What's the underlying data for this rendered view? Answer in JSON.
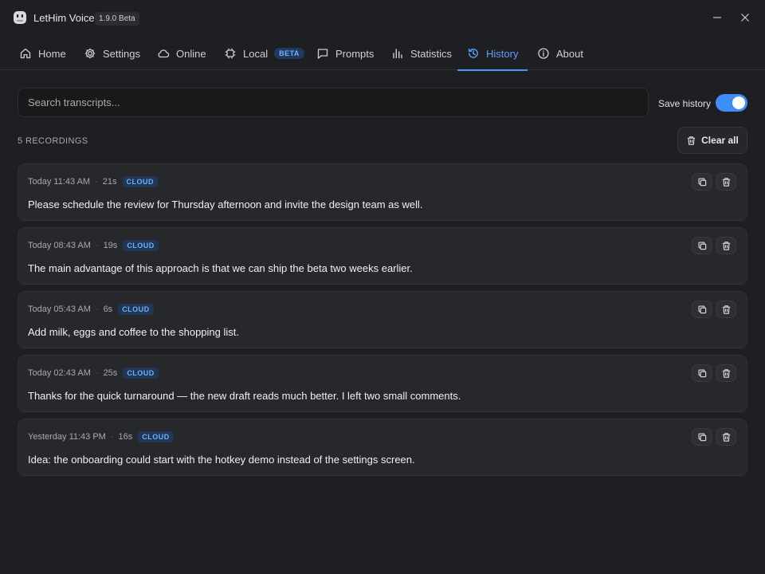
{
  "app": {
    "name": "LetHim Voice",
    "version": "1.9.0 Beta"
  },
  "window": {
    "minimize_icon": "minimize-icon",
    "close_icon": "close-icon"
  },
  "nav": {
    "tabs": [
      {
        "label": "Home",
        "icon": "home-icon"
      },
      {
        "label": "Settings",
        "icon": "gear-icon"
      },
      {
        "label": "Online",
        "icon": "cloud-icon"
      },
      {
        "label": "Local",
        "icon": "chip-icon",
        "badge": "BETA"
      },
      {
        "label": "Prompts",
        "icon": "chat-icon"
      },
      {
        "label": "Statistics",
        "icon": "bar-chart-icon"
      },
      {
        "label": "History",
        "icon": "history-icon",
        "active": true
      },
      {
        "label": "About",
        "icon": "info-icon"
      }
    ]
  },
  "search": {
    "placeholder": "Search transcripts..."
  },
  "save_history": {
    "label": "Save history",
    "enabled": true
  },
  "recordings": {
    "count_label": "5 RECORDINGS",
    "clear_label": "Clear all",
    "items": [
      {
        "time": "Today 11:43 AM",
        "duration": "21s",
        "source": "CLOUD",
        "text": "Please schedule the review for Thursday afternoon and invite the design team as well."
      },
      {
        "time": "Today 08:43 AM",
        "duration": "19s",
        "source": "CLOUD",
        "text": "The main advantage of this approach is that we can ship the beta two weeks earlier."
      },
      {
        "time": "Today 05:43 AM",
        "duration": "6s",
        "source": "CLOUD",
        "text": "Add milk, eggs and coffee to the shopping list."
      },
      {
        "time": "Today 02:43 AM",
        "duration": "25s",
        "source": "CLOUD",
        "text": "Thanks for the quick turnaround — the new draft reads much better. I left two small comments."
      },
      {
        "time": "Yesterday 11:43 PM",
        "duration": "16s",
        "source": "CLOUD",
        "text": "Idea: the onboarding could start with the hotkey demo instead of the settings screen."
      }
    ]
  },
  "colors": {
    "accent": "#4c94f8",
    "background": "#1e1f22",
    "card": "#27282c",
    "badge_text": "#6fb0ff"
  }
}
